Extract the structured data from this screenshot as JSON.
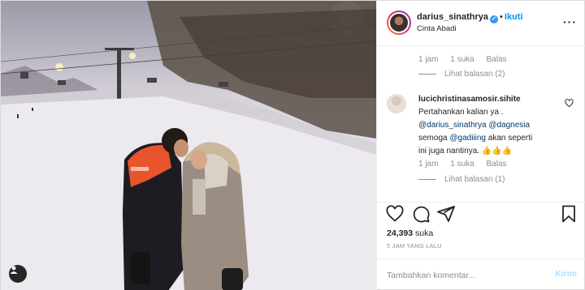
{
  "header": {
    "username": "darius_sinathrya",
    "verified_icon": "verified-badge-icon",
    "separator": "•",
    "follow_label": "Ikuti",
    "location": "Cinta Abadi",
    "more_icon": "more-options-icon"
  },
  "comments": {
    "first_meta": {
      "time": "1 jam",
      "likes": "1 suka",
      "reply": "Balas",
      "view_replies": "Lihat balasan (2)"
    },
    "second": {
      "username": "lucichristinasamosir.sihite",
      "line1": "Pertahankan kalian ya .",
      "mention1": "@darius_sinathrya",
      "mention2": "@dagnesia",
      "line3_prefix": "semoga ",
      "mention3": "@gadiiing",
      "line3_suffix": " akan seperti",
      "line4": "ini juga nantinya. 👍👍👍",
      "time": "1 jam",
      "likes": "1 suka",
      "reply": "Balas",
      "view_replies": "Lihat balasan (1)"
    }
  },
  "actions": {
    "like_icon": "heart-icon",
    "comment_icon": "comment-icon",
    "share_icon": "share-icon",
    "save_icon": "bookmark-icon"
  },
  "likes": {
    "count": "24,393",
    "label": " suka"
  },
  "time_ago": "5 JAM YANG LALU",
  "comment_box": {
    "placeholder": "Tambahkan komentar...",
    "send_label": "Kirim"
  },
  "colors": {
    "accent": "#0095f6",
    "verified": "#3897f0",
    "muted": "#8e8e8e",
    "send_disabled": "#b2dffc"
  }
}
